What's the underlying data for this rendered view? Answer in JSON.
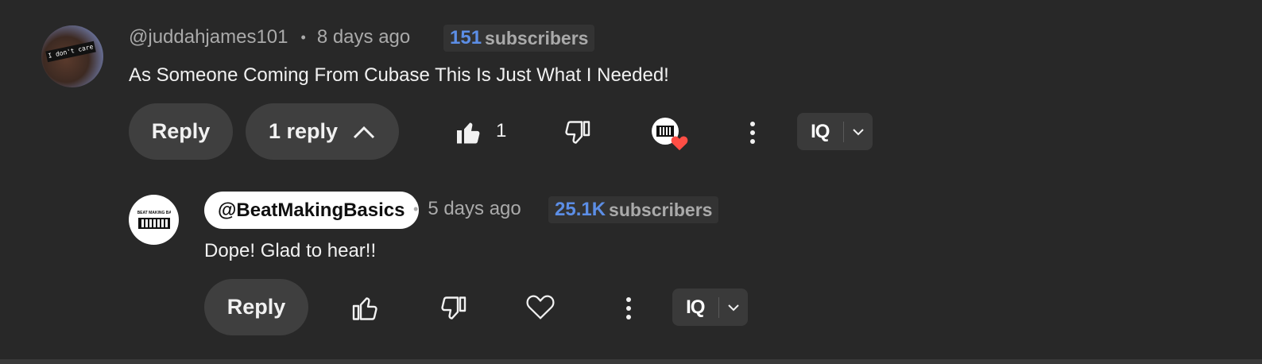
{
  "comment": {
    "author": "@juddahjames101",
    "separator": "•",
    "time": "8 days ago",
    "subscribers_count": "151",
    "subscribers_label": "subscribers",
    "text": "As Someone Coming From Cubase This Is Just What I Needed!",
    "avatar_caption": "I don't care",
    "reply_label": "Reply",
    "replies_label": "1 reply",
    "like_count": "1",
    "extension_logo": "IQ"
  },
  "reply": {
    "author": "@BeatMakingBasics",
    "separator": "•",
    "time": "5 days ago",
    "subscribers_count": "25.1K",
    "subscribers_label": "subscribers",
    "text": "Dope! Glad to hear!!",
    "avatar_caption": "BEAT MAKING BASICS",
    "reply_label": "Reply",
    "extension_logo": "IQ"
  },
  "colors": {
    "background": "#282828",
    "button_bg": "#3f3f3f",
    "subscriber_count": "#5c8ee6",
    "heart": "#ff4e45"
  }
}
